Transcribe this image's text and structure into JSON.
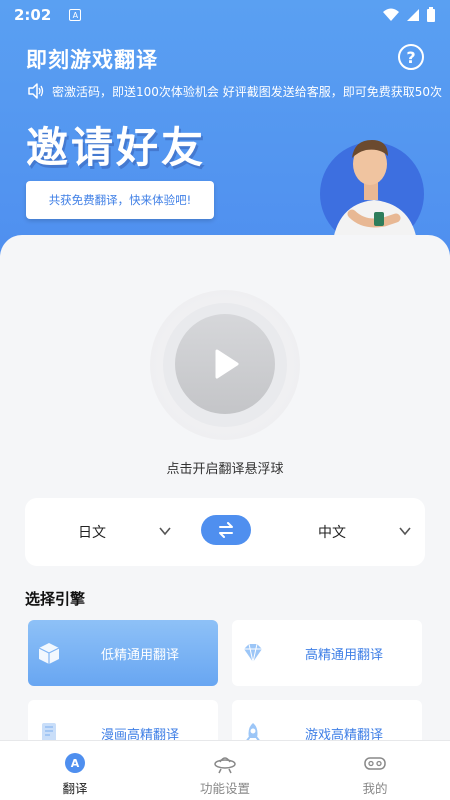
{
  "status": {
    "time": "2:02",
    "badge": "A"
  },
  "app": {
    "title": "即刻游戏翻译"
  },
  "marquee": {
    "text": "密激活码，即送100次体验机会 好评截图发送给客服，即可免费获取50次"
  },
  "invite": {
    "title": "邀请好友",
    "button_label": "共获免费翻译，快来体验吧!"
  },
  "float_ball": {
    "hint": "点击开启翻译悬浮球"
  },
  "languages": {
    "source": "日文",
    "target": "中文"
  },
  "engines": {
    "title": "选择引擎",
    "items": [
      {
        "label": "低精通用翻译",
        "active": true
      },
      {
        "label": "高精通用翻译",
        "active": false
      },
      {
        "label": "漫画高精翻译",
        "active": false
      },
      {
        "label": "游戏高精翻译",
        "active": false
      }
    ]
  },
  "tabs": [
    {
      "label": "翻译",
      "active": true
    },
    {
      "label": "功能设置",
      "active": false
    },
    {
      "label": "我的",
      "active": false
    }
  ],
  "colors": {
    "primary": "#4f8fef",
    "header": "#5aa0f2",
    "background": "#f5f6f8"
  }
}
